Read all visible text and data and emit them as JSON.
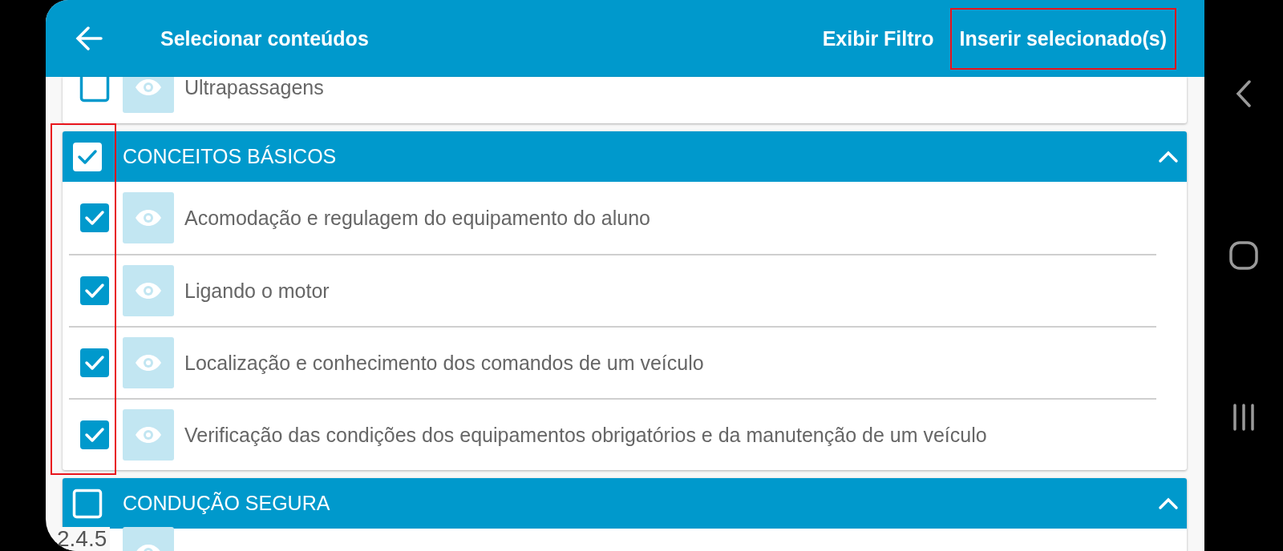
{
  "app_bar": {
    "title": "Selecionar conteúdos",
    "actions": [
      {
        "label": "Exibir Filtro",
        "highlighted": false
      },
      {
        "label": "Inserir selecionado(s)",
        "highlighted": true
      }
    ]
  },
  "sections": [
    {
      "items": [
        {
          "label": "Ultrapassagens",
          "checked": false
        }
      ]
    },
    {
      "title": "CONCEITOS BÁSICOS",
      "checked": true,
      "expanded": true,
      "checkboxes_highlighted": true,
      "items": [
        {
          "label": "Acomodação e regulagem do equipamento do aluno",
          "checked": true
        },
        {
          "label": "Ligando o motor",
          "checked": true
        },
        {
          "label": "Localização e conhecimento dos comandos de um veículo",
          "checked": true
        },
        {
          "label": "Verificação das condições dos equipamentos obrigatórios e da manutenção de um veículo",
          "checked": true
        }
      ]
    },
    {
      "title": "CONDUÇÃO SEGURA",
      "checked": false,
      "expanded": true,
      "checkboxes_highlighted": false,
      "items": [
        {
          "kind": "preview-only"
        }
      ]
    }
  ],
  "version": "2.4.5"
}
